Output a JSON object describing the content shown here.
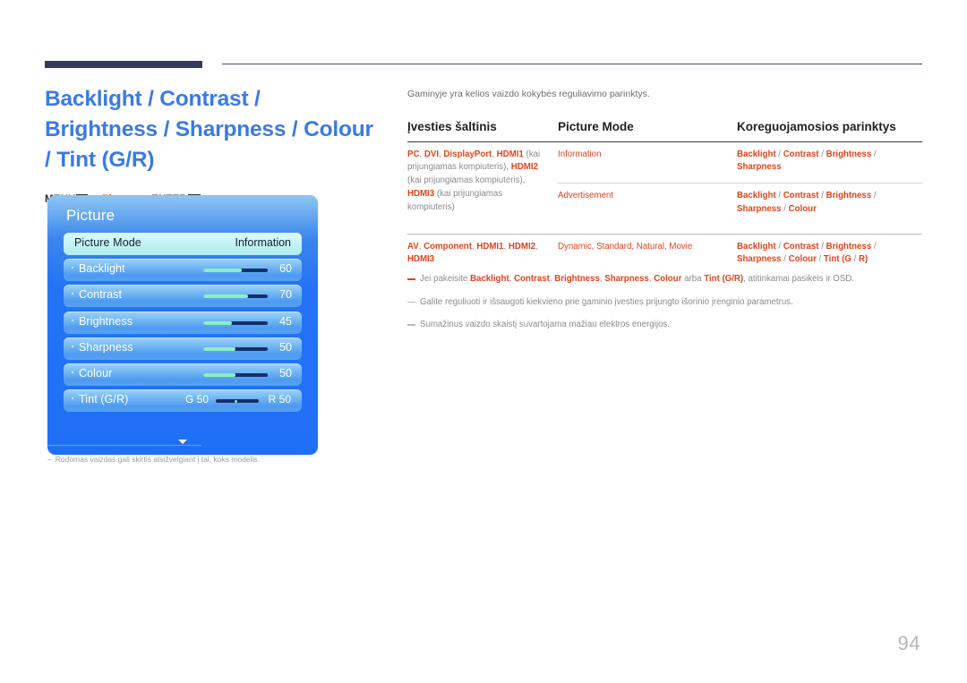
{
  "header": {
    "title": "Backlight / Contrast / Brightness / Sharpness / Colour / Tint (G/R)",
    "breadcrumb": {
      "menu_label": "MENU",
      "menu_icon": "menu-grid-icon",
      "arrow1": "→",
      "picture_label": "Picture",
      "arrow2": "→",
      "enter_label": "ENTER",
      "enter_icon": "enter-return-icon",
      "enter_glyph": "↵"
    }
  },
  "osd": {
    "title": "Picture",
    "rows": [
      {
        "label": "Picture Mode",
        "value": "Information",
        "type": "selected"
      },
      {
        "label": "Backlight",
        "value": "60",
        "fill": 60,
        "type": "slider"
      },
      {
        "label": "Contrast",
        "value": "70",
        "fill": 70,
        "type": "slider"
      },
      {
        "label": "Brightness",
        "value": "45",
        "fill": 45,
        "type": "slider"
      },
      {
        "label": "Sharpness",
        "value": "50",
        "fill": 50,
        "type": "slider"
      },
      {
        "label": "Colour",
        "value": "50",
        "fill": 50,
        "type": "slider"
      },
      {
        "label": "Tint (G/R)",
        "g_value": "G 50",
        "r_value": "R 50",
        "type": "tint"
      }
    ],
    "scroll_arrow": "chevron-down-icon",
    "note": "Rodomas vaizdas gali skirtis atsižvelgiant į tai, koks modelis."
  },
  "content": {
    "intro": "Gaminyje yra kelios vaizdo kokybės reguliavimo parinktys.",
    "table": {
      "headers": [
        "Įvesties šaltinis",
        "Picture Mode",
        "Koreguojamosios parinktys"
      ],
      "rows": [
        {
          "source_parts": [
            {
              "t": "PC",
              "s": "red"
            },
            {
              "t": ", ",
              "s": "gray"
            },
            {
              "t": "DVI",
              "s": "red"
            },
            {
              "t": ", ",
              "s": "gray"
            },
            {
              "t": "DisplayPort",
              "s": "red"
            },
            {
              "t": ", ",
              "s": "gray"
            },
            {
              "t": "HDMI1",
              "s": "red"
            },
            {
              "t": " (kai prijungiamas kompiuteris), ",
              "s": "gray"
            },
            {
              "t": "HDMI2",
              "s": "red"
            },
            {
              "t": " (kai prijungiamas kompiuteris), ",
              "s": "gray"
            },
            {
              "t": "HDMI3",
              "s": "red"
            },
            {
              "t": " (kai prijungiamas kompiuteris)",
              "s": "gray"
            }
          ],
          "mode": "Information",
          "options": "Backlight / Contrast / Brightness / Sharpness"
        },
        {
          "source_parts": [],
          "mode": "Advertisement",
          "options": "Backlight / Contrast / Brightness / Sharpness / Colour"
        },
        {
          "source_parts": [
            {
              "t": "AV",
              "s": "red"
            },
            {
              "t": ", ",
              "s": "gray"
            },
            {
              "t": "Component",
              "s": "red"
            },
            {
              "t": ", ",
              "s": "gray"
            },
            {
              "t": "HDMI1",
              "s": "red"
            },
            {
              "t": ", ",
              "s": "gray"
            },
            {
              "t": "HDMI2",
              "s": "red"
            },
            {
              "t": ", ",
              "s": "gray"
            },
            {
              "t": "HDMI3",
              "s": "red"
            }
          ],
          "mode": "Dynamic, Standard, Natural, Movie",
          "options": "Backlight / Contrast / Brightness / Sharpness / Colour / Tint (G/R)"
        }
      ]
    },
    "notes": [
      {
        "emphasis": true,
        "parts": [
          {
            "t": "Jei pakeisite ",
            "s": "gray"
          },
          {
            "t": "Backlight",
            "s": "red"
          },
          {
            "t": ", ",
            "s": "gray"
          },
          {
            "t": "Contrast",
            "s": "red"
          },
          {
            "t": ", ",
            "s": "gray"
          },
          {
            "t": "Brightness",
            "s": "red"
          },
          {
            "t": ", ",
            "s": "gray"
          },
          {
            "t": "Sharpness",
            "s": "red"
          },
          {
            "t": ", ",
            "s": "gray"
          },
          {
            "t": "Colour",
            "s": "red"
          },
          {
            "t": " arba ",
            "s": "gray"
          },
          {
            "t": "Tint (G/R)",
            "s": "red"
          },
          {
            "t": ", atitinkamai pasikeis ir OSD.",
            "s": "gray"
          }
        ]
      },
      {
        "emphasis": false,
        "parts": [
          {
            "t": "Galite reguliuoti ir išsaugoti kiekvieno prie gaminio įvesties prijungto išorinio įrenginio parametrus.",
            "s": "gray"
          }
        ]
      },
      {
        "emphasis": false,
        "parts": [
          {
            "t": "Sumažinus vaizdo skaistį suvartojama mažiau elektros energijos.",
            "s": "gray"
          }
        ]
      }
    ]
  },
  "footer": {
    "page_number": "94"
  },
  "colors": {
    "title_blue": "#3b7ae4",
    "accent_red": "#e0431c",
    "rule_navy": "#343a5e",
    "osd_blue": "#2572f5",
    "slider_fill": "#8af0c0",
    "slider_track": "#14306b",
    "body_gray": "#8a8b8f"
  }
}
